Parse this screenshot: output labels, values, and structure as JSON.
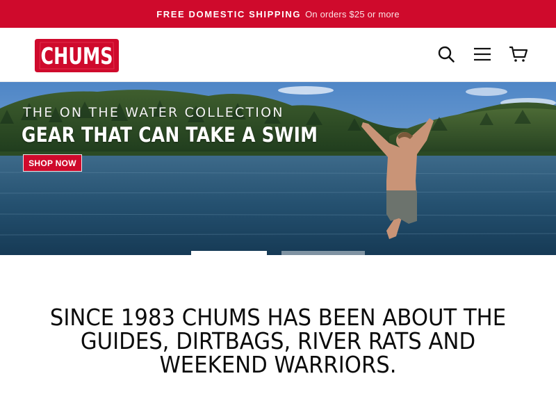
{
  "announcement": {
    "strong": "FREE DOMESTIC SHIPPING",
    "light": "On orders $25 or more"
  },
  "header": {
    "logo_text": "CHUMS",
    "icons": [
      "search-icon",
      "menu-icon",
      "cart-icon"
    ]
  },
  "hero": {
    "eyebrow": "THE ON THE WATER COLLECTION",
    "headline": "GEAR THAT CAN TAKE A SWIM",
    "cta_label": "SHOP NOW",
    "slides": 2,
    "active_slide": 1
  },
  "tagline": "SINCE 1983 CHUMS HAS BEEN ABOUT THE GUIDES, DIRTBAGS, RIVER RATS AND WEEKEND WARRIORS.",
  "colors": {
    "brand_red": "#cf0a2c",
    "text": "#0b0b0b"
  }
}
